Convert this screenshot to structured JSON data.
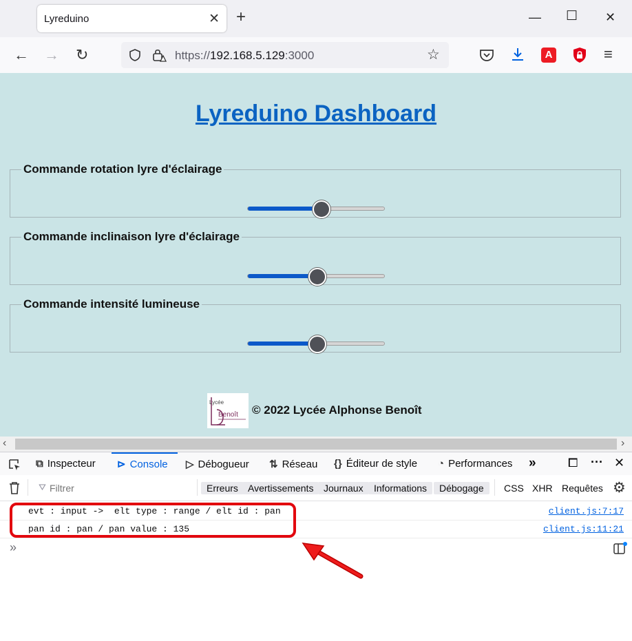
{
  "browser": {
    "tab_title": "Lyreduino",
    "tab_close": "✕",
    "new_tab": "+",
    "win_minimize": "—",
    "win_maximize": "☐",
    "win_close": "✕",
    "url_scheme": "https://",
    "url_host": "192.168.5.129",
    "url_port": ":3000"
  },
  "page": {
    "title": "Lyreduino Dashboard",
    "controls": [
      {
        "legend": "Commande rotation lyre d'éclairage",
        "value": 135,
        "min": 0,
        "max": 255
      },
      {
        "legend": "Commande inclinaison lyre d'éclairage",
        "value": 127,
        "min": 0,
        "max": 255
      },
      {
        "legend": "Commande intensité lumineuse",
        "value": 127,
        "min": 0,
        "max": 255
      }
    ],
    "footer_text": "© 2022 Lycée Alphonse Benoît",
    "logo_text": "Lycée Benoît"
  },
  "devtools": {
    "tabs": [
      "Inspecteur",
      "Console",
      "Débogueur",
      "Réseau",
      "Éditeur de style",
      "Performances"
    ],
    "filter_placeholder": "Filtrer",
    "level_filters": [
      "Erreurs",
      "Avertissements",
      "Journaux",
      "Informations",
      "Débogage"
    ],
    "type_filters": [
      "CSS",
      "XHR",
      "Requêtes"
    ],
    "logs": [
      {
        "message": "evt : input ->  elt type : range / elt id : pan",
        "source": "client.js:7:17"
      },
      {
        "message": "pan id : pan / pan value : 135",
        "source": "client.js:11:21"
      }
    ],
    "prompt": "»"
  },
  "colors": {
    "page_bg": "#cae4e6",
    "title_color": "#0b63c2",
    "accent": "#0061e0",
    "highlight": "#e2070e"
  }
}
